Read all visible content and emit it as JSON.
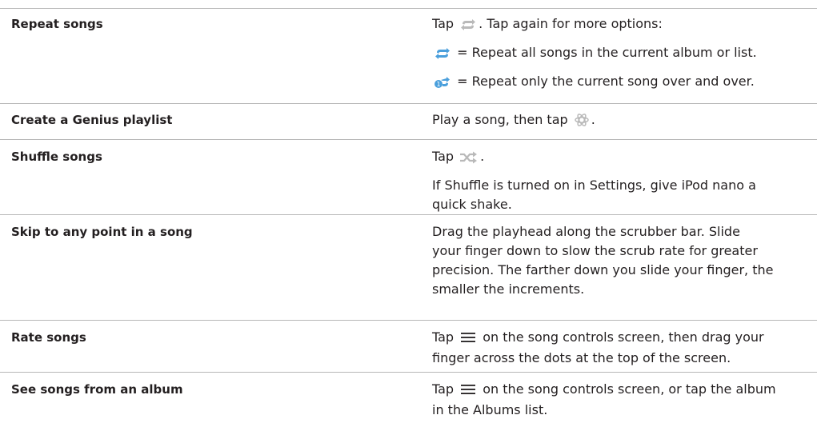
{
  "rows": [
    {
      "action": "Repeat songs",
      "lines": [
        {
          "pre": "Tap ",
          "icon": "repeat-icon",
          "post": ". Tap again for more options:"
        },
        {
          "pre": "",
          "icon": "repeat-all-icon",
          "post": " = Repeat all songs in the current album or list."
        },
        {
          "pre": "",
          "icon": "repeat-one-icon",
          "post": " = Repeat only the current song over and over."
        }
      ]
    },
    {
      "action": "Create a Genius playlist",
      "lines": [
        {
          "pre": "Play a song, then tap ",
          "icon": "genius-icon",
          "post": "."
        }
      ]
    },
    {
      "action": "Shuffle songs",
      "lines": [
        {
          "pre": "Tap ",
          "icon": "shuffle-icon",
          "post": "."
        },
        {
          "text_1": "If Shuffle is turned on in Settings, give iPod nano a",
          "text_2": "quick shake."
        }
      ]
    },
    {
      "action": "Skip to any point in a song",
      "lines": [
        {
          "l1": "Drag the playhead along the scrubber bar. Slide",
          "l2": "your finger down to slow the scrub rate for greater",
          "l3": "precision. The farther down you slide your finger, the",
          "l4": "smaller the increments."
        }
      ]
    },
    {
      "action": "Rate songs",
      "lines": [
        {
          "pre": "Tap ",
          "icon": "list-icon",
          "post": " on the song controls screen, then drag your",
          "l2": "finger across the dots at the top of the screen."
        }
      ]
    },
    {
      "action": "See songs from an album",
      "lines": [
        {
          "pre": "Tap ",
          "icon": "list-icon",
          "post": " on the song controls screen, or tap the album",
          "l2": "in the Albums list."
        }
      ]
    }
  ],
  "colors": {
    "text": "#231f20",
    "rule": "#b7b7b7",
    "icon_gray": "#b9b9b9",
    "icon_blue": "#4a9fdc"
  }
}
